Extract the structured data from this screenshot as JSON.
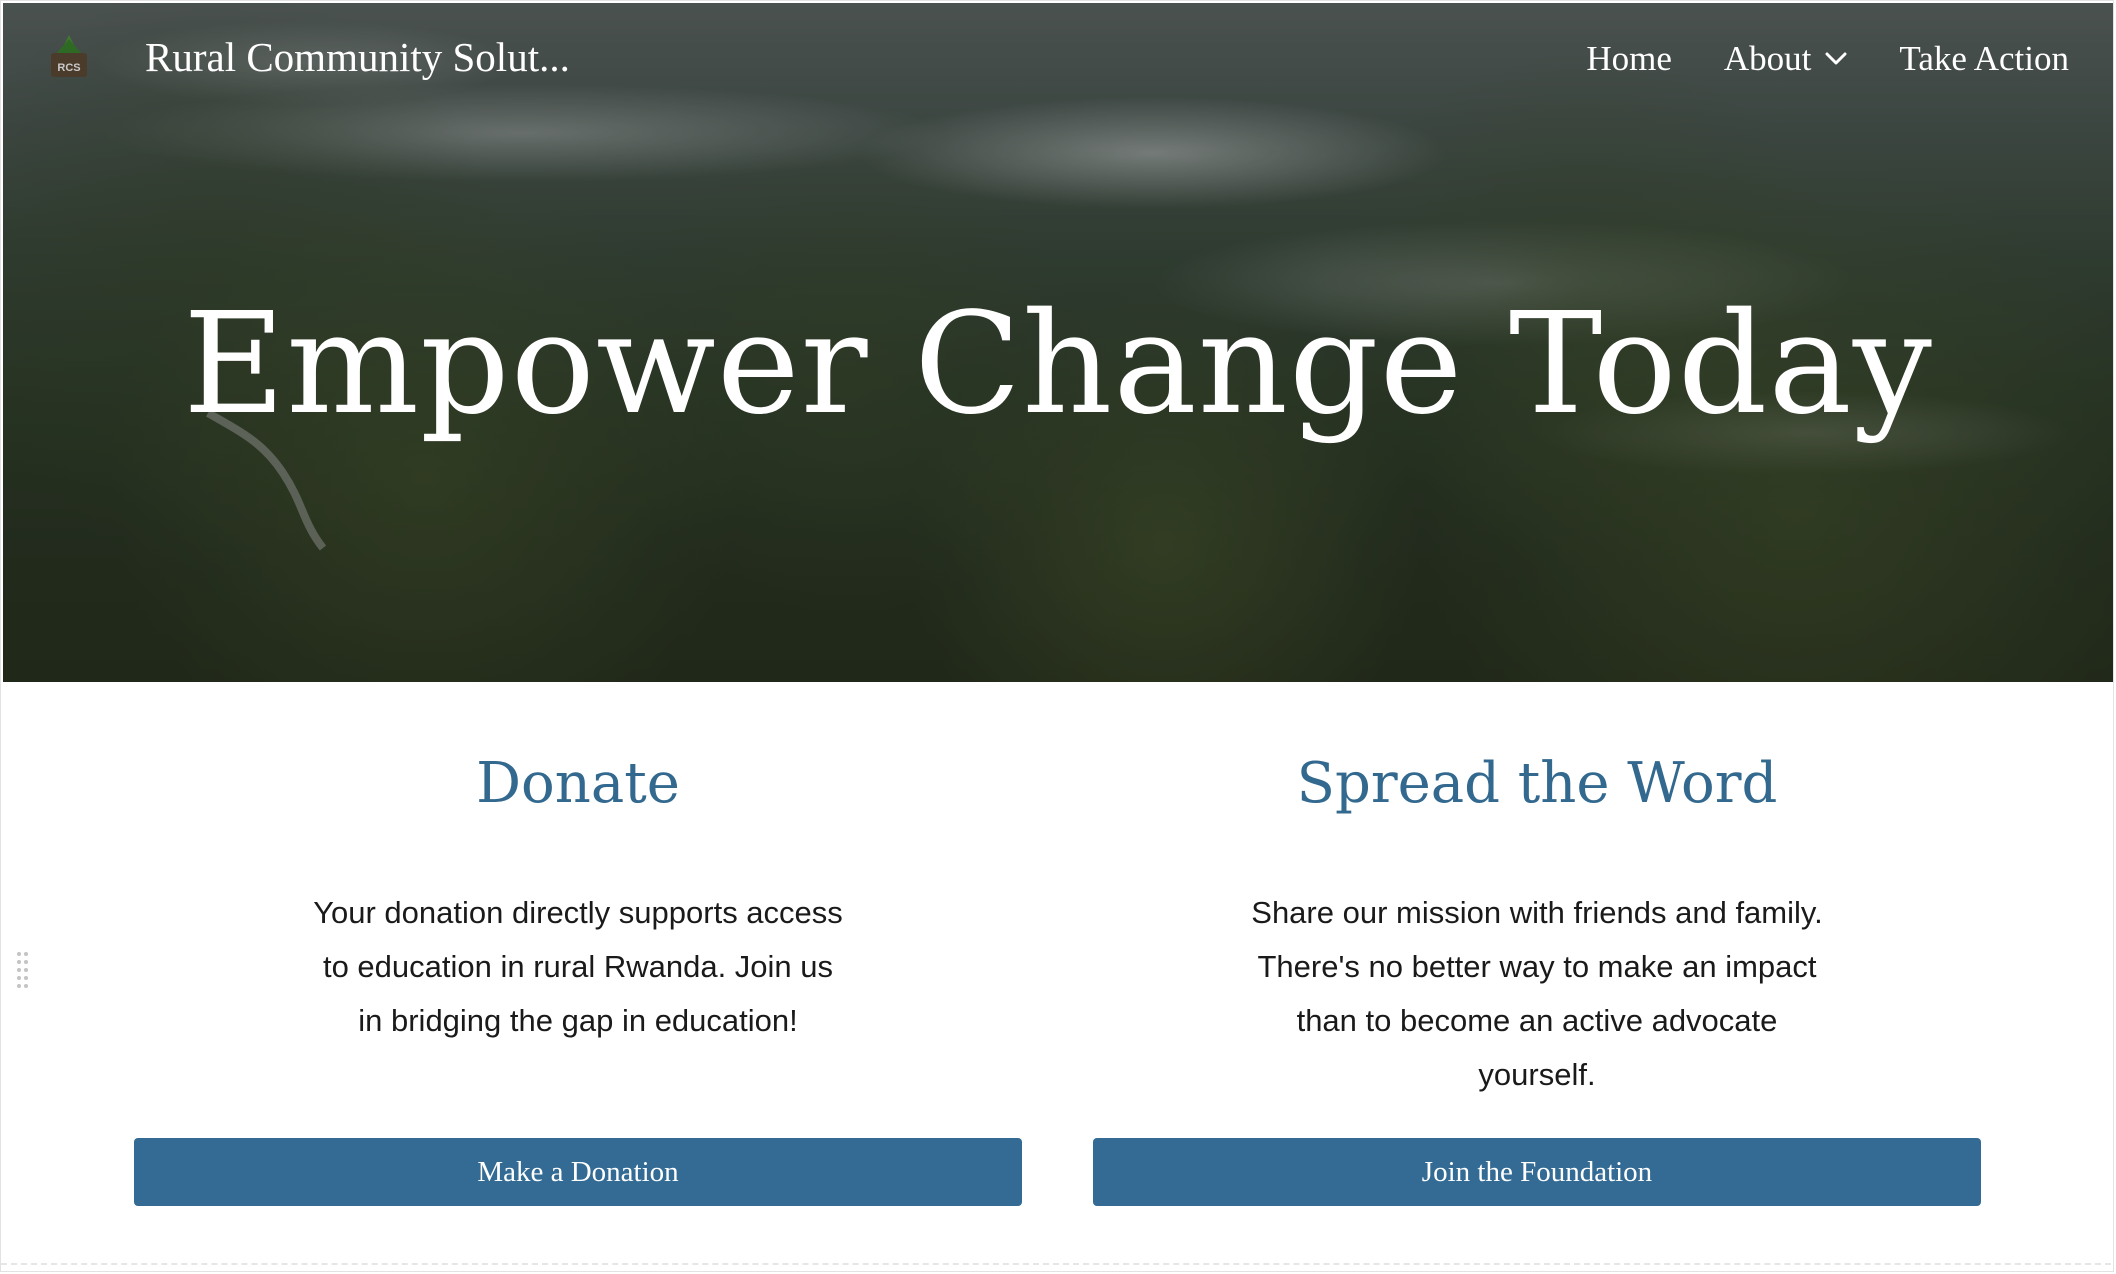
{
  "header": {
    "site_title": "Rural Community Solut...",
    "logo_text": "RCS",
    "nav": [
      {
        "label": "Home"
      },
      {
        "label": "About"
      },
      {
        "label": "Take Action"
      }
    ]
  },
  "hero": {
    "title": "Empower Change Today"
  },
  "donate": {
    "heading": "Donate",
    "text": "Your donation directly supports access to education in rural Rwanda. Join us in bridging the gap in education!",
    "button_label": "Make a Donation"
  },
  "spread": {
    "heading": "Spread the Word",
    "text": "Share our mission with friends and family. There's no better way to make an impact than to become an active advocate yourself.",
    "button_label": "Join the Foundation"
  },
  "colors": {
    "accent": "#336b94",
    "heading": "#33698f"
  },
  "icons": {
    "about_dropdown": "chevron-down-icon",
    "logo": "rcs-logo-icon",
    "drag": "drag-handle-icon"
  }
}
